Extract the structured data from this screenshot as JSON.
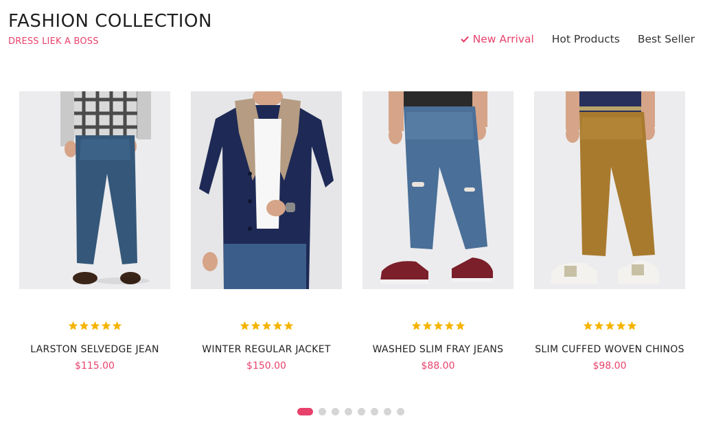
{
  "header": {
    "title": "FASHION COLLECTION",
    "subtitle": "DRESS LIEK A BOSS"
  },
  "tabs": [
    {
      "label": "New Arrival",
      "active": true,
      "icon": "check-icon"
    },
    {
      "label": "Hot Products",
      "active": false
    },
    {
      "label": "Best Seller",
      "active": false
    }
  ],
  "products": [
    {
      "name": "LARSTON SELVEDGE JEAN",
      "price": "$115.00",
      "rating": 5
    },
    {
      "name": "WINTER REGULAR JACKET",
      "price": "$150.00",
      "rating": 5
    },
    {
      "name": "WASHED SLIM FRAY JEANS",
      "price": "$88.00",
      "rating": 5
    },
    {
      "name": "SLIM CUFFED WOVEN CHINOS",
      "price": "$98.00",
      "rating": 5
    }
  ],
  "pagination": {
    "count": 8,
    "active_index": 0
  },
  "colors": {
    "accent": "#e8416b",
    "star": "#f5b400",
    "dot": "#d5d5d5"
  }
}
